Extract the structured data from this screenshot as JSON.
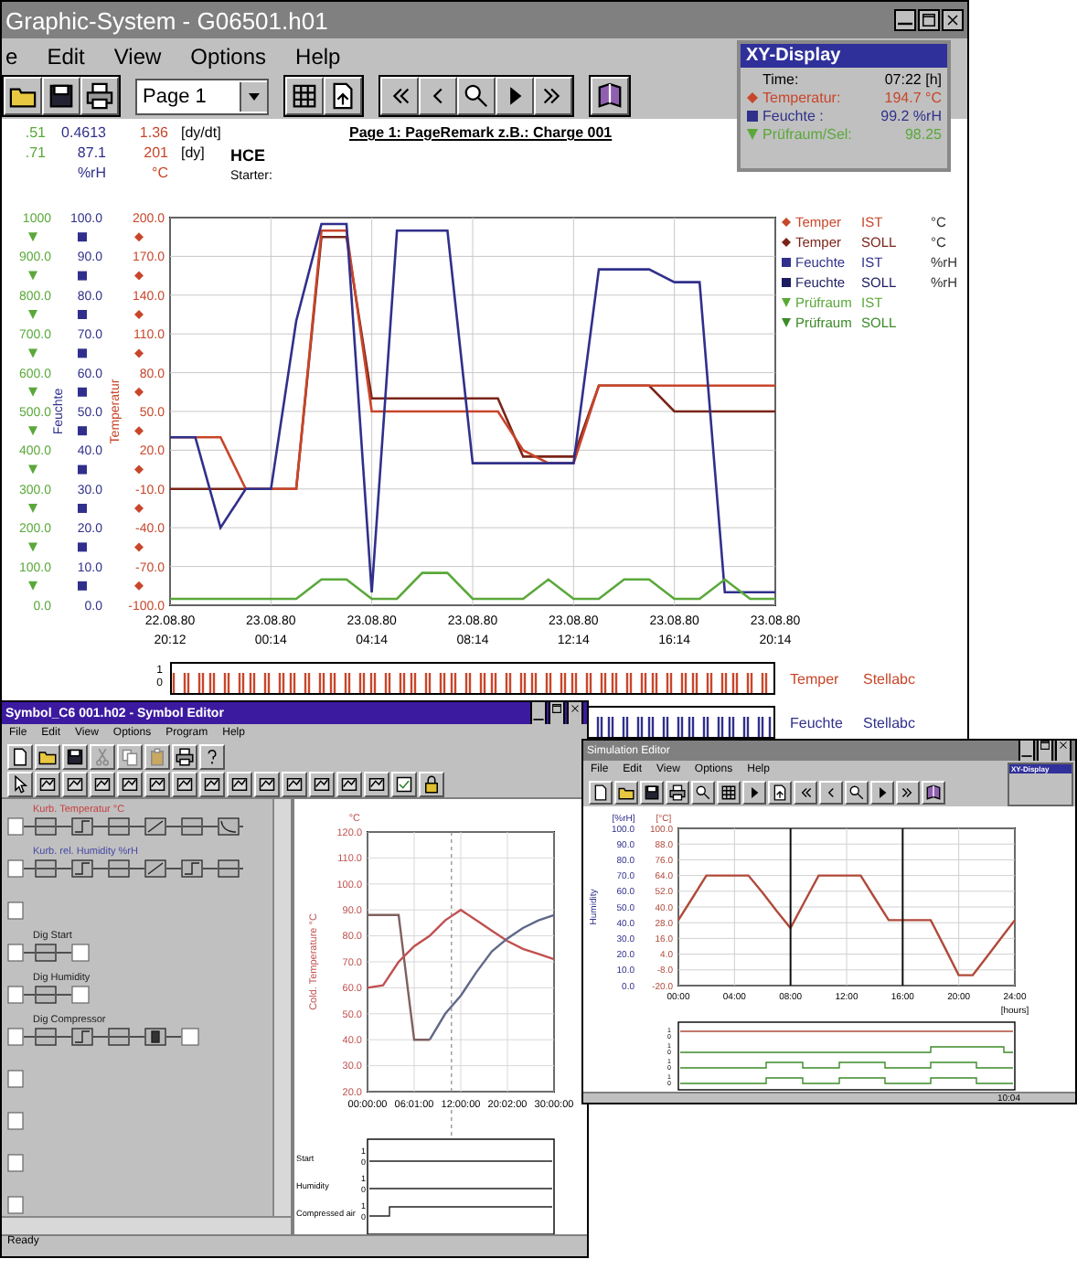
{
  "main_window": {
    "title": "Graphic-System - G06501.h01",
    "menu": [
      "e",
      "Edit",
      "View",
      "Options",
      "Help"
    ],
    "toolbar": [
      {
        "kind": "buttons",
        "items": [
          {
            "kind": "folder"
          },
          {
            "kind": "disk"
          },
          {
            "kind": "printer"
          }
        ]
      },
      {
        "kind": "select",
        "value": "Page 1"
      },
      {
        "kind": "buttons",
        "items": [
          {
            "kind": "grid"
          },
          {
            "kind": "export"
          }
        ]
      },
      {
        "kind": "buttons",
        "items": [
          {
            "kind": "first"
          },
          {
            "kind": "prev"
          },
          {
            "kind": "zoom"
          },
          {
            "kind": "next"
          },
          {
            "kind": "last"
          }
        ]
      },
      {
        "kind": "buttons",
        "items": [
          {
            "kind": "book"
          }
        ]
      }
    ],
    "header": {
      "readouts": [
        [
          ".51",
          "0.4613",
          "1.36",
          "[dy/dt]"
        ],
        [
          ".71",
          "87.1",
          "201",
          "[dy]"
        ]
      ],
      "units": [
        "%rH",
        "°C"
      ],
      "program": "HCE",
      "starter": "Starter:",
      "page_remark": "Page 1: PageRemark z.B.: Charge 001"
    },
    "axes": [
      {
        "kind": "triangle",
        "color": "#5aa83a",
        "ticks": [
          "1000",
          "900.0",
          "800.0",
          "700.0",
          "600.0",
          "500.0",
          "400.0",
          "300.0",
          "200.0",
          "100.0",
          "0.0"
        ]
      },
      {
        "kind": "square",
        "color": "#30308c",
        "title": "Feuchte",
        "ticks": [
          "100.0",
          "90.0",
          "80.0",
          "70.0",
          "60.0",
          "50.0",
          "40.0",
          "30.0",
          "20.0",
          "10.0",
          "0.0"
        ]
      }
    ],
    "chart_data": {
      "type": "line",
      "grid": true,
      "ylabel": "Temperatur",
      "ylim": [
        -100,
        200
      ],
      "categories": [
        "22.08.80 20:12",
        null,
        null,
        null,
        "23.08.80 00:14",
        null,
        null,
        null,
        "23.08.80 04:14",
        null,
        null,
        null,
        "23.08.80 08:14",
        null,
        null,
        null,
        "23.08.80 12:14",
        null,
        null,
        null,
        "23.08.80 16:14",
        null,
        null,
        null,
        "23.08.80 20:14"
      ],
      "yticks": [
        {
          "value": 200,
          "label": "200.0"
        },
        {
          "value": 170,
          "label": "170.0"
        },
        {
          "value": 140,
          "label": "140.0"
        },
        {
          "value": 110,
          "label": "110.0"
        },
        {
          "value": 80,
          "label": "80.0"
        },
        {
          "value": 50,
          "label": "50.0"
        },
        {
          "value": 20,
          "label": "20.0"
        },
        {
          "value": -10,
          "label": "-10.0"
        },
        {
          "value": -40,
          "label": "-40.0"
        },
        {
          "value": -70,
          "label": "-70.0"
        },
        {
          "value": -100,
          "label": "-100.0"
        }
      ],
      "series": [
        {
          "color": "#7a2418",
          "values": [
            -10,
            -10,
            -10,
            -10,
            -10,
            -10,
            185,
            185,
            60,
            60,
            60,
            60,
            60,
            60,
            15,
            15,
            15,
            70,
            70,
            70,
            50,
            50,
            50,
            50,
            50
          ]
        },
        {
          "color": "#c8462a",
          "values": [
            30,
            30,
            30,
            -10,
            -10,
            -10,
            190,
            190,
            50,
            50,
            50,
            50,
            50,
            50,
            20,
            10,
            10,
            70,
            70,
            70,
            70,
            70,
            70,
            70,
            70
          ]
        },
        {
          "color": "#30308c",
          "values": [
            30,
            30,
            -40,
            -10,
            -10,
            120,
            195,
            195,
            -90,
            190,
            190,
            190,
            10,
            10,
            10,
            10,
            10,
            160,
            160,
            160,
            150,
            150,
            -90,
            -90,
            -90
          ]
        },
        {
          "color": "#5aa83a",
          "values": [
            -95,
            -95,
            -95,
            -95,
            -95,
            -95,
            -80,
            -80,
            -95,
            -95,
            -75,
            -75,
            -95,
            -95,
            -95,
            -80,
            -95,
            -95,
            -80,
            -80,
            -95,
            -95,
            -80,
            -95,
            -95
          ]
        }
      ]
    },
    "legend": [
      {
        "kind": "diamond",
        "color": "#c8462a",
        "name": "Temper",
        "mode": "IST",
        "unit": "°C"
      },
      {
        "kind": "diamond",
        "color": "#7a2418",
        "name": "Temper",
        "mode": "SOLL",
        "unit": "°C"
      },
      {
        "kind": "square",
        "color": "#30308c",
        "name": "Feuchte",
        "mode": "IST",
        "unit": "%rH"
      },
      {
        "kind": "square",
        "color": "#1c1c60",
        "name": "Feuchte",
        "mode": "SOLL",
        "unit": "%rH"
      },
      {
        "kind": "triangle",
        "color": "#5aa83a",
        "name": "Prüfraum",
        "mode": "IST"
      },
      {
        "kind": "triangle",
        "color": "#3c8a28",
        "name": "Prüfraum",
        "mode": "SOLL"
      }
    ],
    "strips": [
      {
        "color": "#c8462a",
        "ticks": [
          "1",
          "0"
        ],
        "name": "Temper",
        "label": "Stellabc"
      },
      {
        "color": "#30308c",
        "name": "Feuchte",
        "label": "Stellabc"
      }
    ]
  },
  "xy_display": {
    "title": "XY-Display",
    "rows": [
      {
        "kind": "plain",
        "label": "Time:",
        "value": "07:22 [h]"
      },
      {
        "kind": "diamond",
        "color": "#c8462a",
        "label": "Temperatur:",
        "value": "194.7 °C"
      },
      {
        "kind": "square",
        "color": "#30308c",
        "label": "Feuchte :",
        "value": "99.2 %rH"
      },
      {
        "kind": "triangle",
        "color": "#5aa83a",
        "label": "Prüfraum/Sel:",
        "value": "98.25"
      }
    ]
  },
  "symbol_editor": {
    "title": "Symbol_C6 001.h02 - Symbol Editor",
    "menu": [
      "File",
      "Edit",
      "View",
      "Options",
      "Program",
      "Help"
    ],
    "toolbar_rows": [
      [
        {
          "kind": "new",
          "disabled": false
        },
        {
          "kind": "folder",
          "disabled": false
        },
        {
          "kind": "disk",
          "disabled": false
        },
        {
          "kind": "cut",
          "disabled": true
        },
        {
          "kind": "copy",
          "disabled": true
        },
        {
          "kind": "paste",
          "disabled": true
        },
        {
          "kind": "printer",
          "disabled": false
        },
        {
          "kind": "help",
          "disabled": false
        }
      ],
      [
        {
          "kind": "pointer",
          "disabled": false
        },
        {
          "kind": "block",
          "disabled": false
        },
        {
          "kind": "block",
          "disabled": false
        },
        {
          "kind": "block",
          "disabled": false
        },
        {
          "kind": "block",
          "disabled": false
        },
        {
          "kind": "block",
          "disabled": false
        },
        {
          "kind": "block",
          "disabled": false
        },
        {
          "kind": "block",
          "disabled": false
        },
        {
          "kind": "block",
          "disabled": false
        },
        {
          "kind": "block",
          "disabled": false
        },
        {
          "kind": "block",
          "disabled": false
        },
        {
          "kind": "block",
          "disabled": false
        },
        {
          "kind": "block",
          "disabled": false
        },
        {
          "kind": "block",
          "disabled": false
        },
        {
          "kind": "check",
          "disabled": false
        },
        {
          "kind": "lock",
          "disabled": false
        }
      ]
    ],
    "channels": [
      {
        "kind": "analog",
        "label": "Kurb. Temperatur °C",
        "color": "#c84040",
        "blocks": [
          {
            "kind": "flat"
          },
          {
            "kind": "step"
          },
          {
            "kind": "flat"
          },
          {
            "kind": "ramp"
          },
          {
            "kind": "flat"
          },
          {
            "kind": "curve"
          }
        ],
        "end": false
      },
      {
        "kind": "analog",
        "label": "Kurb. rel. Humidity %rH",
        "color": "#4848a8",
        "blocks": [
          {
            "kind": "flat"
          },
          {
            "kind": "step"
          },
          {
            "kind": "flat"
          },
          {
            "kind": "ramp"
          },
          {
            "kind": "step"
          },
          {
            "kind": "flat"
          }
        ],
        "end": false
      },
      {
        "kind": "empty",
        "end": false
      },
      {
        "kind": "digital",
        "label": "Dig Start",
        "color": "#202020",
        "blocks": [
          {
            "kind": "flat"
          }
        ],
        "end": true
      },
      {
        "kind": "digital",
        "label": "Dig Humidity",
        "color": "#202020",
        "blocks": [
          {
            "kind": "flat"
          }
        ],
        "end": true
      },
      {
        "kind": "digital",
        "label": "Dig Compressor",
        "color": "#202020",
        "blocks": [
          {
            "kind": "flat"
          },
          {
            "kind": "step"
          },
          {
            "kind": "flat"
          },
          {
            "kind": "bar"
          }
        ],
        "end": true
      },
      {
        "kind": "empty",
        "end": false
      },
      {
        "kind": "empty",
        "end": false
      },
      {
        "kind": "empty",
        "end": false
      },
      {
        "kind": "empty",
        "end": false
      }
    ],
    "chart_unit": "°C",
    "chart_data": {
      "type": "line",
      "grid": true,
      "ylabel": "Cold. Temperature °C",
      "ylim": [
        20,
        120
      ],
      "categories": [
        "00:00:00",
        null,
        null,
        "06:01:00",
        null,
        null,
        "12:00:00",
        null,
        null,
        "20:02:00",
        null,
        null,
        "30:00:00"
      ],
      "yticks": [
        {
          "value": 120,
          "label": "120.0"
        },
        {
          "value": 110,
          "label": "110.0"
        },
        {
          "value": 100,
          "label": "100.0"
        },
        {
          "value": 90,
          "label": "90.0"
        },
        {
          "value": 80,
          "label": "80.0"
        },
        {
          "value": 70,
          "label": "70.0"
        },
        {
          "value": 60,
          "label": "60.0"
        },
        {
          "value": 50,
          "label": "50.0"
        },
        {
          "value": 40,
          "label": "40.0"
        },
        {
          "value": 30,
          "label": "30.0"
        },
        {
          "value": 20,
          "label": "20.0"
        }
      ],
      "series": [
        {
          "color": "#806060",
          "values": [
            88,
            88,
            88,
            40,
            40,
            null,
            null,
            null,
            null,
            null,
            null,
            null,
            null
          ]
        },
        {
          "color": "#c05050",
          "values": [
            60,
            61,
            70,
            76,
            80,
            86,
            90,
            86,
            82,
            78,
            75,
            73,
            71
          ]
        },
        {
          "color": "#606888",
          "values": [
            null,
            null,
            null,
            null,
            40,
            50,
            57,
            66,
            74,
            79,
            83,
            86,
            88
          ]
        }
      ]
    },
    "digital": [
      {
        "kind": "low",
        "label": "Start",
        "ticks": [
          "1",
          "0"
        ]
      },
      {
        "kind": "low",
        "label": "Humidity",
        "ticks": [
          "1",
          "0"
        ]
      },
      {
        "kind": "rise",
        "label": "Compressed air",
        "ticks": [
          "1",
          "0"
        ]
      }
    ],
    "status": "Ready"
  },
  "simulation_window": {
    "title": "Simulation Editor",
    "menu": [
      "File",
      "Edit",
      "View",
      "Options",
      "Help"
    ],
    "toolbar": [
      {
        "kind": "new"
      },
      {
        "kind": "folder"
      },
      {
        "kind": "disk"
      },
      {
        "kind": "printer"
      },
      {
        "kind": "zoom"
      },
      {
        "kind": "grid"
      },
      {
        "kind": "next"
      },
      {
        "kind": "export"
      },
      {
        "kind": "first"
      },
      {
        "kind": "prev"
      },
      {
        "kind": "zoom"
      },
      {
        "kind": "next"
      },
      {
        "kind": "last"
      },
      {
        "kind": "book"
      }
    ],
    "xy_display": {
      "title": "XY-Display"
    },
    "units": [
      "[%rH]",
      "[°C]"
    ],
    "ylabel": "Humidity",
    "hum_ticks": [
      "100.0",
      "90.0",
      "80.0",
      "70.0",
      "60.0",
      "50.0",
      "40.0",
      "30.0",
      "20.0",
      "10.0",
      "0.0"
    ],
    "chart_data": {
      "type": "line",
      "grid": true,
      "ylim": [
        -20,
        100
      ],
      "categories": [
        "00:00",
        null,
        null,
        null,
        "04:00",
        null,
        null,
        null,
        "08:00",
        null,
        null,
        null,
        "12:00",
        null,
        null,
        null,
        "16:00",
        null,
        null,
        null,
        "20:00",
        null,
        null,
        null,
        "24:00"
      ],
      "yticks": [
        {
          "value": 100,
          "label": "100.0"
        },
        {
          "value": 88,
          "label": "88.0"
        },
        {
          "value": 76,
          "label": "76.0"
        },
        {
          "value": 64,
          "label": "64.0"
        },
        {
          "value": 52,
          "label": "52.0"
        },
        {
          "value": 40,
          "label": "40.0"
        },
        {
          "value": 28,
          "label": "28.0"
        },
        {
          "value": 16,
          "label": "16.0"
        },
        {
          "value": 4,
          "label": "4.0"
        },
        {
          "value": -8,
          "label": "-8.0"
        },
        {
          "value": -20,
          "label": "-20.0"
        }
      ],
      "series": [
        {
          "color": "#b04a3a",
          "values": [
            30,
            47,
            64,
            64,
            64,
            64,
            51,
            37,
            24,
            44,
            64,
            64,
            64,
            64,
            47,
            30,
            30,
            30,
            30,
            9,
            -12,
            -12,
            2,
            16,
            30
          ]
        }
      ]
    },
    "x_unit": "[hours]",
    "digital": [
      {
        "kind": "high",
        "ticks": [
          "1",
          "0"
        ]
      },
      {
        "kind": "pulse",
        "ticks": [
          "1",
          "0"
        ]
      },
      {
        "kind": "blocks",
        "ticks": [
          "1",
          "0"
        ]
      },
      {
        "kind": "blocks",
        "ticks": [
          "1",
          "0"
        ]
      }
    ],
    "status": "10:04"
  }
}
